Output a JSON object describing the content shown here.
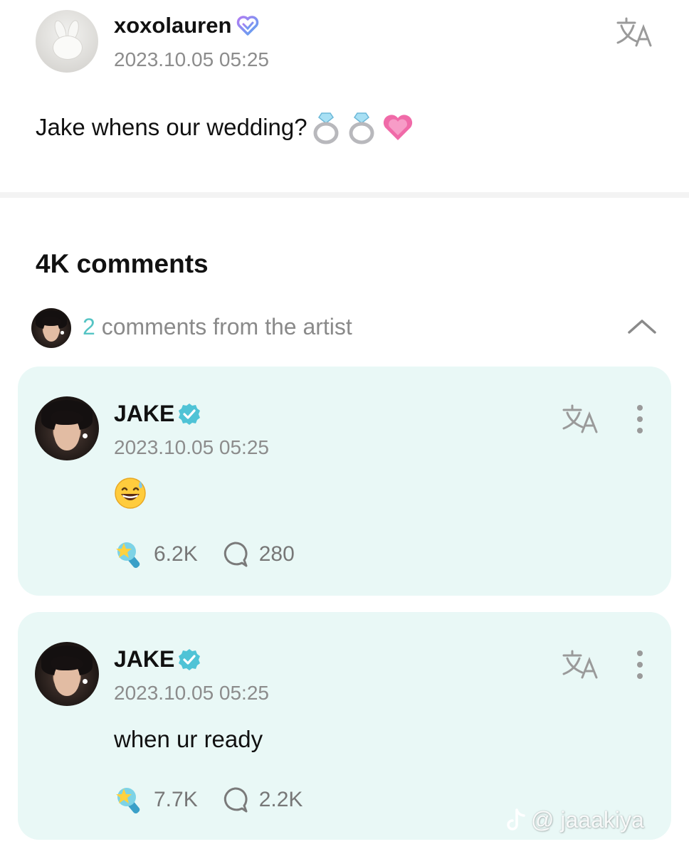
{
  "post": {
    "username": "xoxolauren",
    "timestamp": "2023.10.05 05:25",
    "text": "Jake whens our wedding?",
    "emoji_icons": [
      "ring-icon",
      "ring-icon",
      "pink-heart-icon"
    ]
  },
  "comments_header": {
    "title": "4K comments",
    "artist_count": "2",
    "artist_text": " comments from the artist"
  },
  "comments": [
    {
      "author": "JAKE",
      "timestamp": "2023.10.05 05:25",
      "content_icon": "grinning-sweat-emoji-icon",
      "likes": "6.2K",
      "replies": "280"
    },
    {
      "author": "JAKE",
      "timestamp": "2023.10.05 05:25",
      "text": "when ur ready",
      "likes": "7.7K",
      "replies": "2.2K"
    }
  ],
  "watermark": {
    "handle": "@ jaaakiya"
  },
  "colors": {
    "card_background": "#e9f8f6",
    "accent_teal": "#55c4c4",
    "verified_badge": "#4fc3d6",
    "muted_text": "#8c8c8c"
  }
}
